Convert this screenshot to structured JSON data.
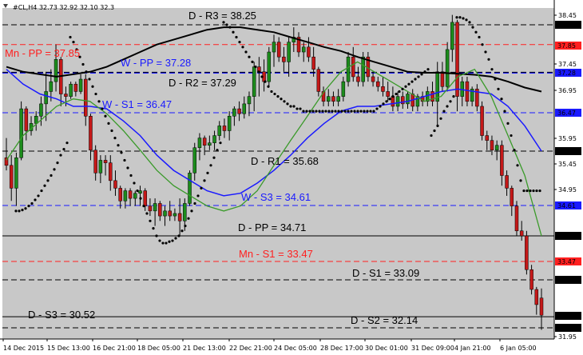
{
  "header": {
    "symbol_text": "#CL,H4  32.73 32.92 32.10 32.3"
  },
  "colors": {
    "background": "#c8c8c8",
    "pivot_daily": "#000000",
    "pivot_weekly": "#1a1aff",
    "pivot_monthly": "#ff2020",
    "candle_up": "#1c8c1c",
    "candle_down": "#c41818",
    "ma_black": "#000000",
    "ma_blue": "#1a1aff",
    "ma_green": "#3a9a2a",
    "psar": "#000000",
    "current_price_box": "#000000"
  },
  "chart_data": {
    "type": "candlestick",
    "title": "",
    "ylim": [
      31.5,
      38.75
    ],
    "y_ticks": [
      "38.45",
      "38.25",
      "37.85",
      "37.45",
      "37.28",
      "36.95",
      "36.47",
      "35.95",
      "35.68",
      "35.45",
      "34.95",
      "34.61",
      "34.00",
      "33.47",
      "33.09",
      "32.39",
      "32.14",
      "31.95"
    ],
    "x_tick_labels": [
      "14 Dec 2015",
      "15 Dec 13:00",
      "16 Dec 21:00",
      "18 Dec 05:00",
      "21 Dec 13:00",
      "22 Dec 21:00",
      "24 Dec 05:00",
      "28 Dec 17:00",
      "30 Dec 01:00",
      "31 Dec 09:00",
      "4 Jan 21:00",
      "6 Jan 05:00"
    ],
    "current_price": "32.39",
    "pivot_levels": [
      {
        "name": "D - R3",
        "value": 38.25,
        "text": "D - R3 = 38.25",
        "group": "daily",
        "line": "dashed",
        "price_label": "38.25"
      },
      {
        "name": "Mn - PP",
        "value": 37.85,
        "text": "Mn - PP = 37.85",
        "group": "monthly",
        "line": "dashed",
        "price_label": "37.85"
      },
      {
        "name": "W - PP",
        "value": 37.28,
        "text": "W - PP = 37.28",
        "group": "weekly",
        "line": "dashed",
        "price_label": "37.28"
      },
      {
        "name": "D - R2",
        "value": 37.29,
        "text": "D - R2 = 37.29",
        "group": "daily",
        "line": "dashed",
        "price_label": ""
      },
      {
        "name": "W - S1",
        "value": 36.47,
        "text": "W - S1 = 36.47",
        "group": "weekly",
        "line": "dashed",
        "price_label": "36.47"
      },
      {
        "name": "D - R1",
        "value": 35.68,
        "text": "D - R1 = 35.68",
        "group": "daily",
        "line": "dashed",
        "price_label": "35.68"
      },
      {
        "name": "W - S3",
        "value": 34.61,
        "text": "W - S3 = 34.61",
        "group": "weekly",
        "line": "dashed",
        "price_label": "34.61"
      },
      {
        "name": "D - PP",
        "value": 34.0,
        "text": "D - PP = 34.71",
        "group": "daily",
        "line": "solid",
        "price_label": "34.00"
      },
      {
        "name": "Mn - S1",
        "value": 33.47,
        "text": "Mn - S1 = 33.47",
        "group": "monthly",
        "line": "dashed",
        "price_label": "33.47"
      },
      {
        "name": "D - S1",
        "value": 33.09,
        "text": "D - S1 = 33.09",
        "group": "daily",
        "line": "dashed",
        "price_label": "33.09"
      },
      {
        "name": "D - S3",
        "value": 32.36,
        "text": "D - S3 = 30.52",
        "group": "daily",
        "line": "solid",
        "price_label": ""
      },
      {
        "name": "D - S2",
        "value": 32.14,
        "text": "D - S2 = 32.14",
        "group": "daily",
        "line": "dashed",
        "price_label": "32.14"
      }
    ],
    "candles": [
      [
        35.55,
        35.95,
        35.3,
        35.4
      ],
      [
        35.4,
        35.6,
        34.7,
        34.95
      ],
      [
        34.95,
        35.65,
        34.6,
        35.55
      ],
      [
        35.55,
        36.7,
        35.5,
        36.55
      ],
      [
        36.55,
        36.6,
        35.9,
        36.1
      ],
      [
        36.1,
        36.4,
        36.0,
        36.25
      ],
      [
        36.25,
        36.5,
        36.1,
        36.4
      ],
      [
        36.4,
        36.8,
        36.2,
        36.65
      ],
      [
        36.65,
        37.3,
        36.3,
        36.9
      ],
      [
        36.9,
        37.35,
        36.7,
        37.1
      ],
      [
        37.1,
        37.85,
        36.9,
        37.55
      ],
      [
        37.55,
        37.6,
        36.6,
        36.85
      ],
      [
        36.85,
        37.0,
        36.6,
        36.8
      ],
      [
        36.8,
        37.1,
        36.75,
        37.05
      ],
      [
        37.05,
        37.1,
        36.8,
        36.9
      ],
      [
        36.9,
        37.25,
        36.85,
        37.15
      ],
      [
        37.15,
        37.25,
        36.2,
        36.4
      ],
      [
        36.4,
        36.45,
        35.5,
        35.7
      ],
      [
        35.7,
        35.8,
        35.1,
        35.25
      ],
      [
        35.25,
        35.6,
        35.05,
        35.5
      ],
      [
        35.5,
        35.6,
        35.2,
        35.45
      ],
      [
        35.45,
        35.6,
        34.9,
        35.1
      ],
      [
        35.1,
        35.3,
        34.8,
        34.95
      ],
      [
        34.95,
        35.0,
        34.55,
        34.7
      ],
      [
        34.7,
        34.95,
        34.55,
        34.9
      ],
      [
        34.9,
        34.95,
        34.6,
        34.75
      ],
      [
        34.75,
        34.9,
        34.6,
        34.85
      ],
      [
        34.85,
        35.0,
        34.6,
        34.9
      ],
      [
        34.9,
        34.95,
        34.5,
        34.6
      ],
      [
        34.6,
        34.75,
        34.4,
        34.5
      ],
      [
        34.5,
        34.75,
        34.2,
        34.65
      ],
      [
        34.65,
        34.7,
        34.3,
        34.4
      ],
      [
        34.4,
        34.6,
        34.2,
        34.5
      ],
      [
        34.5,
        34.7,
        34.3,
        34.4
      ],
      [
        34.4,
        34.55,
        34.3,
        34.45
      ],
      [
        34.45,
        34.75,
        34.0,
        34.3
      ],
      [
        34.3,
        34.75,
        34.1,
        34.65
      ],
      [
        34.65,
        35.3,
        34.6,
        35.25
      ],
      [
        35.25,
        35.85,
        35.1,
        35.75
      ],
      [
        35.75,
        36.05,
        35.5,
        35.95
      ],
      [
        35.95,
        36.0,
        35.6,
        35.8
      ],
      [
        35.8,
        36.0,
        35.7,
        35.85
      ],
      [
        35.85,
        36.1,
        35.7,
        36.0
      ],
      [
        36.0,
        36.3,
        35.9,
        36.2
      ],
      [
        36.2,
        36.35,
        35.95,
        36.1
      ],
      [
        36.1,
        36.5,
        35.9,
        36.4
      ],
      [
        36.4,
        36.6,
        36.2,
        36.55
      ],
      [
        36.55,
        36.7,
        36.3,
        36.45
      ],
      [
        36.45,
        36.8,
        36.35,
        36.65
      ],
      [
        36.65,
        36.9,
        36.4,
        36.8
      ],
      [
        36.8,
        37.5,
        36.5,
        37.4
      ],
      [
        37.4,
        37.6,
        36.8,
        37.3
      ],
      [
        37.3,
        37.55,
        36.9,
        37.1
      ],
      [
        37.1,
        37.8,
        37.0,
        37.7
      ],
      [
        37.7,
        38.05,
        37.4,
        37.9
      ],
      [
        37.9,
        38.0,
        37.5,
        37.6
      ],
      [
        37.6,
        37.8,
        37.3,
        37.5
      ],
      [
        37.5,
        38.0,
        37.2,
        37.9
      ],
      [
        37.9,
        38.2,
        37.7,
        38.0
      ],
      [
        38.0,
        38.1,
        37.6,
        37.7
      ],
      [
        37.7,
        37.9,
        37.5,
        37.8
      ],
      [
        37.8,
        38.0,
        37.5,
        37.6
      ],
      [
        37.6,
        37.8,
        37.2,
        37.35
      ],
      [
        37.35,
        37.4,
        36.8,
        36.9
      ],
      [
        36.9,
        37.0,
        36.6,
        36.7
      ],
      [
        36.7,
        36.95,
        36.6,
        36.8
      ],
      [
        36.8,
        36.9,
        36.6,
        36.7
      ],
      [
        36.7,
        36.95,
        36.6,
        36.8
      ],
      [
        36.8,
        37.2,
        36.7,
        37.1
      ],
      [
        37.1,
        37.7,
        37.0,
        37.6
      ],
      [
        37.6,
        37.8,
        37.1,
        37.2
      ],
      [
        37.2,
        37.4,
        37.0,
        37.1
      ],
      [
        37.1,
        37.7,
        37.0,
        37.6
      ],
      [
        37.6,
        37.7,
        37.1,
        37.2
      ],
      [
        37.2,
        37.3,
        37.0,
        37.1
      ],
      [
        37.1,
        37.2,
        36.9,
        37.0
      ],
      [
        37.0,
        37.2,
        36.8,
        36.9
      ],
      [
        36.9,
        37.1,
        36.7,
        36.8
      ],
      [
        36.8,
        37.0,
        36.5,
        36.6
      ],
      [
        36.6,
        36.9,
        36.5,
        36.8
      ],
      [
        36.8,
        36.9,
        36.55,
        36.65
      ],
      [
        36.65,
        36.9,
        36.55,
        36.85
      ],
      [
        36.85,
        36.95,
        36.5,
        36.6
      ],
      [
        36.6,
        36.85,
        36.5,
        36.8
      ],
      [
        36.8,
        36.9,
        36.6,
        36.7
      ],
      [
        36.7,
        37.0,
        36.6,
        36.9
      ],
      [
        36.9,
        37.1,
        36.6,
        36.7
      ],
      [
        36.7,
        37.5,
        36.2,
        37.3
      ],
      [
        37.3,
        37.5,
        36.9,
        37.0
      ],
      [
        37.0,
        37.9,
        36.9,
        37.75
      ],
      [
        37.75,
        38.45,
        37.5,
        38.3
      ],
      [
        38.3,
        38.35,
        36.5,
        36.8
      ],
      [
        36.8,
        37.2,
        36.6,
        37.1
      ],
      [
        37.1,
        37.2,
        36.6,
        36.7
      ],
      [
        36.7,
        37.0,
        36.6,
        36.95
      ],
      [
        36.95,
        37.05,
        36.5,
        36.6
      ],
      [
        36.6,
        36.7,
        35.9,
        36.0
      ],
      [
        36.0,
        36.1,
        35.7,
        35.9
      ],
      [
        35.9,
        36.0,
        35.6,
        35.7
      ],
      [
        35.7,
        35.9,
        35.5,
        35.8
      ],
      [
        35.8,
        35.9,
        35.0,
        35.2
      ],
      [
        35.2,
        35.3,
        34.8,
        34.95
      ],
      [
        34.95,
        35.0,
        34.4,
        34.6
      ],
      [
        34.6,
        34.7,
        34.0,
        34.1
      ],
      [
        34.1,
        34.3,
        33.9,
        34.0
      ],
      [
        34.0,
        34.1,
        33.2,
        33.3
      ],
      [
        33.3,
        33.4,
        32.8,
        32.9
      ],
      [
        32.9,
        32.95,
        32.4,
        32.6
      ],
      [
        32.73,
        32.92,
        32.1,
        32.39
      ]
    ],
    "ma_black": [
      37.4,
      37.3,
      37.25,
      37.2,
      37.25,
      37.3,
      37.4,
      37.55,
      37.7,
      37.85,
      37.95,
      38.05,
      38.15,
      38.2,
      38.2,
      38.15,
      38.1,
      38.0,
      37.9,
      37.8,
      37.72,
      37.6,
      37.5,
      37.4,
      37.3,
      37.28,
      37.28,
      37.26,
      37.24,
      37.2,
      37.1,
      36.98,
      36.9
    ],
    "ma_blue": [
      37.35,
      37.05,
      36.85,
      36.75,
      36.6,
      36.6,
      36.55,
      36.3,
      36.0,
      35.6,
      35.3,
      35.1,
      34.9,
      34.8,
      34.85,
      35.05,
      35.3,
      35.6,
      35.95,
      36.25,
      36.5,
      36.6,
      36.6,
      36.65,
      36.7,
      36.8,
      36.9,
      36.95,
      36.9,
      36.85,
      36.6,
      36.2,
      35.68
    ],
    "ma_green": [
      35.5,
      36.0,
      36.3,
      36.6,
      36.75,
      36.7,
      36.45,
      36.1,
      35.7,
      35.3,
      35.0,
      34.8,
      34.6,
      34.5,
      34.6,
      34.9,
      35.4,
      35.9,
      36.4,
      36.9,
      37.3,
      37.5,
      37.3,
      37.1,
      36.9,
      36.7,
      36.8,
      37.2,
      37.35,
      36.8,
      36.0,
      35.2,
      34.0
    ],
    "psar_x": [
      20,
      24,
      28,
      32,
      36,
      40,
      44,
      48,
      52,
      56,
      60,
      64,
      68,
      72,
      76,
      80,
      84,
      88,
      92,
      96,
      100,
      104,
      108,
      112,
      116,
      120,
      124,
      128,
      132,
      136,
      140,
      144,
      148,
      152,
      156,
      160,
      164,
      168,
      172,
      176,
      180,
      184,
      188,
      192,
      196,
      200,
      204,
      208,
      212,
      216,
      220,
      224,
      228,
      232,
      236,
      240,
      244,
      248,
      252,
      256,
      260,
      264,
      268,
      272,
      276,
      280,
      284,
      288,
      292,
      296,
      300,
      304,
      308,
      312,
      316,
      320,
      324,
      328,
      332,
      336,
      340,
      344,
      348,
      352,
      356,
      360,
      364,
      368,
      372,
      376,
      380,
      384,
      388,
      392,
      396,
      400,
      404,
      408,
      412,
      416,
      420,
      424,
      428,
      432,
      436,
      440,
      444,
      448,
      452,
      456,
      460,
      464,
      468,
      472,
      476,
      480,
      484,
      488,
      492,
      496,
      500,
      504,
      508,
      512,
      516,
      520,
      524,
      528,
      532,
      536,
      540,
      544,
      548,
      552,
      556,
      560,
      564,
      568,
      572,
      576,
      580,
      584,
      588,
      592,
      596,
      600,
      604,
      608,
      612,
      616,
      620,
      624,
      628,
      632,
      636,
      640,
      644,
      648,
      652,
      656,
      660,
      664,
      668,
      672,
      676,
      680
    ],
    "psar_y": [
      34.5,
      34.5,
      34.52,
      34.55,
      34.6,
      34.65,
      34.72,
      34.8,
      34.9,
      35.0,
      35.1,
      35.2,
      35.32,
      35.45,
      35.6,
      35.72,
      35.85,
      38.0,
      37.9,
      37.75,
      37.6,
      37.45,
      37.3,
      37.15,
      37.0,
      36.85,
      36.7,
      36.55,
      36.4,
      36.25,
      36.1,
      35.95,
      35.8,
      35.65,
      35.5,
      35.35,
      35.2,
      35.05,
      34.9,
      34.75,
      34.6,
      34.45,
      34.3,
      34.15,
      34.0,
      33.9,
      33.85,
      33.85,
      33.88,
      33.9,
      33.95,
      34.0,
      34.1,
      34.2,
      34.35,
      34.5,
      34.65,
      34.8,
      34.95,
      35.1,
      35.25,
      35.4,
      35.55,
      35.7,
      35.85,
      38.3,
      38.25,
      38.2,
      38.1,
      38.0,
      37.9,
      37.8,
      37.7,
      37.6,
      37.5,
      37.4,
      37.3,
      37.2,
      37.1,
      37.0,
      36.9,
      36.85,
      36.8,
      36.75,
      36.7,
      36.65,
      36.6,
      36.6,
      36.55,
      36.55,
      36.5,
      36.5,
      36.5,
      36.5,
      36.5,
      36.5,
      36.5,
      36.5,
      36.5,
      36.5,
      36.5,
      36.5,
      36.5,
      36.5,
      36.5,
      36.5,
      36.5,
      36.5,
      36.5,
      36.5,
      36.5,
      36.5,
      36.5,
      36.55,
      36.6,
      36.65,
      36.7,
      36.75,
      36.8,
      36.85,
      36.9,
      36.95,
      37.0,
      37.05,
      37.1,
      37.15,
      37.2,
      37.25,
      37.3,
      37.35,
      36.0,
      36.1,
      36.2,
      36.35,
      36.5,
      36.6,
      36.7,
      36.8,
      38.4,
      38.4,
      38.38,
      38.35,
      38.3,
      38.2,
      38.1,
      38.0,
      37.85,
      37.7,
      37.55,
      37.35,
      37.15,
      36.95,
      36.75,
      36.5,
      36.25,
      36.0,
      35.7,
      35.4,
      35.1,
      34.9,
      34.9,
      34.9,
      34.9,
      34.9,
      34.9
    ]
  }
}
